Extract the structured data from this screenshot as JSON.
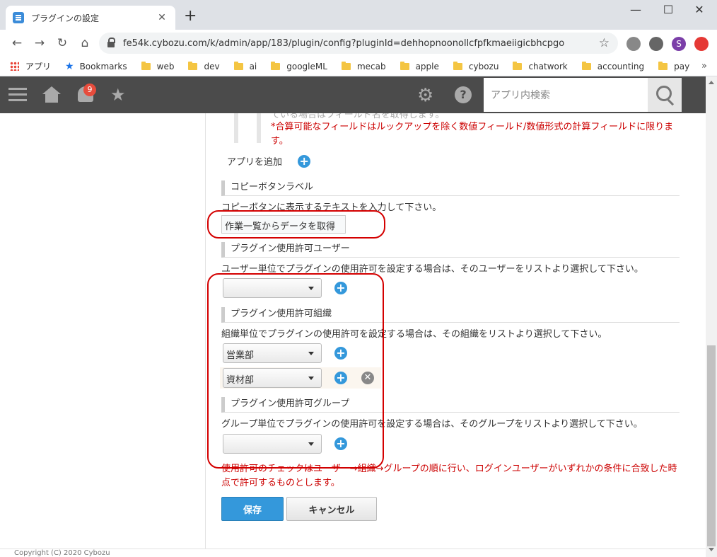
{
  "browser": {
    "tab_title": "プラグインの設定",
    "tab_close": "✕",
    "new_tab": "+",
    "window_controls": {
      "minimize": "—",
      "maximize": "☐",
      "close": "✕"
    },
    "url": "fe54k.cybozu.com/k/admin/app/183/plugin/config?pluginId=dehhopnoonollcfpfkmaeiigicbhcpgo",
    "nav": {
      "back": "←",
      "forward": "→",
      "reload": "↻",
      "home": "⌂"
    },
    "star": "☆",
    "profile_initial": "S",
    "bookmarks": [
      "アプリ",
      "Bookmarks",
      "web",
      "dev",
      "ai",
      "googleML",
      "mecab",
      "apple",
      "cybozu",
      "chatwork",
      "accounting",
      "pay"
    ],
    "bookmarks_more": "»"
  },
  "kintone_header": {
    "notification_count": "9",
    "search_placeholder": "アプリ内検索",
    "help_glyph": "?",
    "gear_glyph": "⚙",
    "star_glyph": "★"
  },
  "content": {
    "ghost_line": "ている場合はフィールド名を取得します。",
    "calc_note": "*合算可能なフィールドはルックアップを除く数値フィールド/数値形式の計算フィールドに限ります。",
    "add_app_label": "アプリを追加",
    "copy_button_section": {
      "title": "コピーボタンラベル",
      "description": "コピーボタンに表示するテキストを入力して下さい。",
      "value": "作業一覧からデータを取得"
    },
    "user_section": {
      "title": "プラグイン使用許可ユーザー",
      "description": "ユーザー単位でプラグインの使用許可を設定する場合は、そのユーザーをリストより選択して下さい。",
      "selected": ""
    },
    "org_section": {
      "title": "プラグイン使用許可組織",
      "description": "組織単位でプラグインの使用許可を設定する場合は、その組織をリストより選択して下さい。",
      "rows": [
        "営業部",
        "資材部"
      ]
    },
    "group_section": {
      "title": "プラグイン使用許可グループ",
      "description": "グループ単位でプラグインの使用許可を設定する場合は、そのグループをリストより選択して下さい。",
      "selected": ""
    },
    "permission_note": "使用許可のチェックはユーザー→組織→グループの順に行い、ログインユーザーがいずれかの条件に合致した時点で許可するものとします。",
    "plus_glyph": "+",
    "remove_glyph": "✕",
    "save_label": "保存",
    "cancel_label": "キャンセル"
  },
  "footer": {
    "copyright": "Copyright (C) 2020 Cybozu"
  },
  "colors": {
    "accent": "#3498db",
    "annotation": "#d40000",
    "note_red": "#cc0000",
    "header_bg": "#4b4b4b"
  }
}
